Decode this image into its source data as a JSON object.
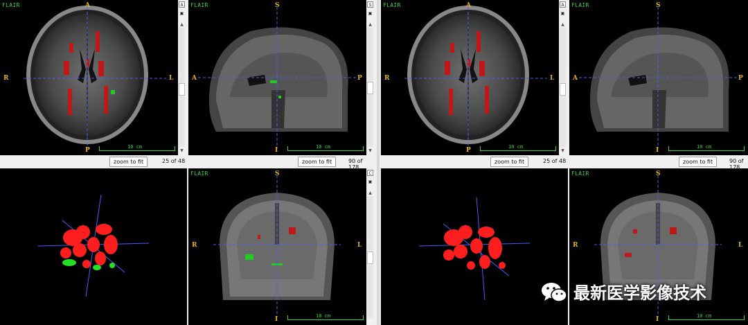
{
  "labels": {
    "sequence": "FLAIR",
    "scale": "10 cm",
    "zoom": "zoom to fit"
  },
  "orientation": {
    "axial": {
      "top": "A",
      "bottom": "P",
      "left": "R",
      "right": "L"
    },
    "sagittal": {
      "top": "S",
      "bottom": "I",
      "left": "A",
      "right": "P"
    },
    "coronal": {
      "top": "S",
      "bottom": "I",
      "left": "R",
      "right": "L"
    }
  },
  "views": {
    "axial": {
      "button": "A",
      "slice": "25 of 48"
    },
    "sagittal": {
      "button": "S",
      "slice": "90 of 178"
    },
    "coronal": {
      "button": "C",
      "slice": ""
    }
  },
  "colors": {
    "lesion": "#ff2020",
    "alt_lesion": "#22cc22",
    "crosshair": "#4a5cff",
    "annotation": "#3cd23c",
    "orientation": "#e6b420"
  },
  "watermark": {
    "icon": "wechat-icon",
    "text": "最新医学影像技术"
  }
}
